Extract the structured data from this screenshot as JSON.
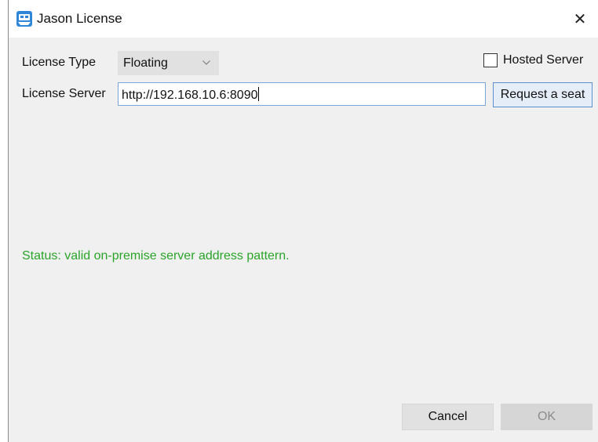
{
  "window": {
    "title": "Jason License",
    "icon": "jason-app-icon",
    "close_glyph": "✕"
  },
  "form": {
    "license_type_label": "License Type",
    "license_type_value": "Floating",
    "hosted_server_label": "Hosted Server",
    "hosted_server_checked": false,
    "license_server_label": "License Server",
    "license_server_value": "http://192.168.10.6:8090",
    "request_seat_label": "Request a seat"
  },
  "status": {
    "text": "Status: valid on-premise server address pattern.",
    "color": "#2aa52a"
  },
  "footer": {
    "cancel_label": "Cancel",
    "ok_label": "OK",
    "ok_enabled": false
  }
}
